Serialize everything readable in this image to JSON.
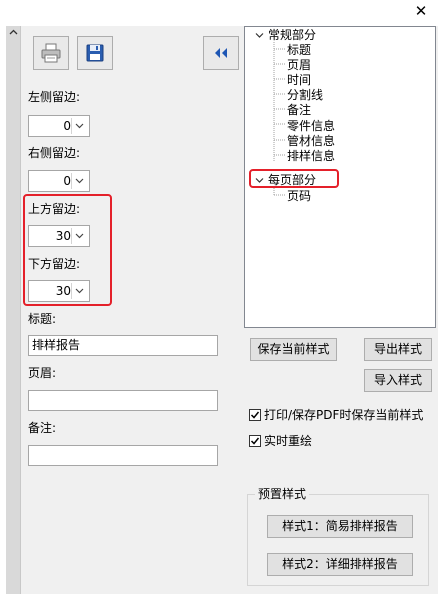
{
  "window": {
    "close_glyph": "✕"
  },
  "toolbar": {
    "print_icon": "printer-icon",
    "save_icon": "floppy-disk-icon",
    "collapse_icon": "double-left-arrow-icon"
  },
  "margins": {
    "left_label": "左侧留边:",
    "left_value": "0",
    "right_label": "右侧留边:",
    "right_value": "0",
    "top_label": "上方留边:",
    "top_value": "30",
    "bottom_label": "下方留边:",
    "bottom_value": "30"
  },
  "fields": {
    "title_label": "标题:",
    "title_value": "排样报告",
    "header_label": "页眉:",
    "header_value": "",
    "note_label": "备注:",
    "note_value": ""
  },
  "tree": {
    "general": {
      "label": "常规部分",
      "children": [
        "标题",
        "页眉",
        "时间",
        "分割线",
        "备注",
        "零件信息",
        "管材信息",
        "排样信息"
      ]
    },
    "per_page": {
      "label": "每页部分",
      "children": [
        "页码"
      ]
    }
  },
  "actions": {
    "save_style": "保存当前样式",
    "export_style": "导出样式",
    "import_style": "导入样式"
  },
  "options": {
    "save_on_print": "打印/保存PDF时保存当前样式",
    "save_on_print_checked": true,
    "realtime_redraw": "实时重绘",
    "realtime_redraw_checked": true
  },
  "presets": {
    "group_label": "预置样式",
    "style1": "样式1：简易排样报告",
    "style2": "样式2：详细排样报告"
  },
  "colors": {
    "highlight": "#e4202a",
    "panel": "#f0f0f0",
    "accent": "#1e56b4"
  }
}
